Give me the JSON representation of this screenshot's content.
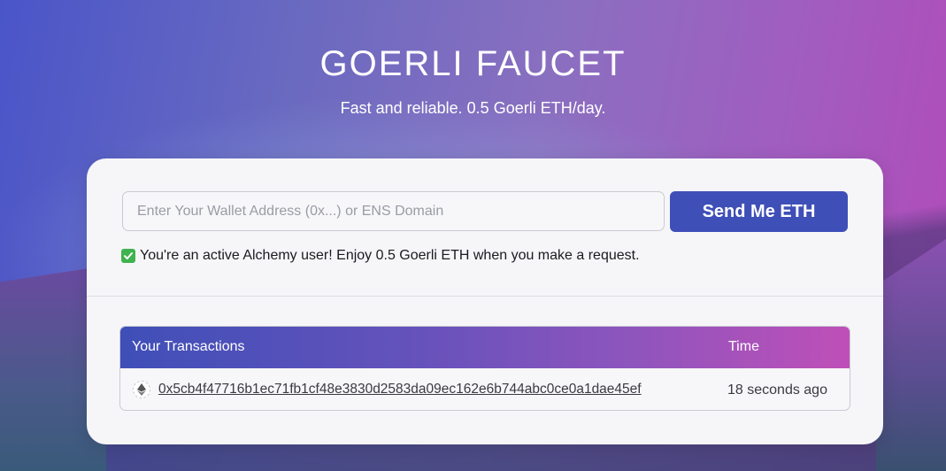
{
  "header": {
    "title": "GOERLI FAUCET",
    "subtitle": "Fast and reliable. 0.5 Goerli ETH/day."
  },
  "form": {
    "wallet_placeholder": "Enter Your Wallet Address (0x...) or ENS Domain",
    "wallet_value": "",
    "send_button_label": "Send Me ETH"
  },
  "notice": {
    "icon": "check-icon",
    "text": "You're an active Alchemy user! Enjoy 0.5 Goerli ETH when you make a request."
  },
  "transactions": {
    "columns": [
      "Your Transactions",
      "Time"
    ],
    "rows": [
      {
        "icon": "ethereum-icon",
        "hash": "0x5cb4f47716b1ec71fb1cf48e3830d2583da09ec162e6b744abc0ce0a1dae45ef",
        "time": "18 seconds ago"
      }
    ]
  },
  "colors": {
    "accent": "#3f4fb8",
    "check": "#3fb34f",
    "header_gradient_end": "#c04fb8"
  }
}
